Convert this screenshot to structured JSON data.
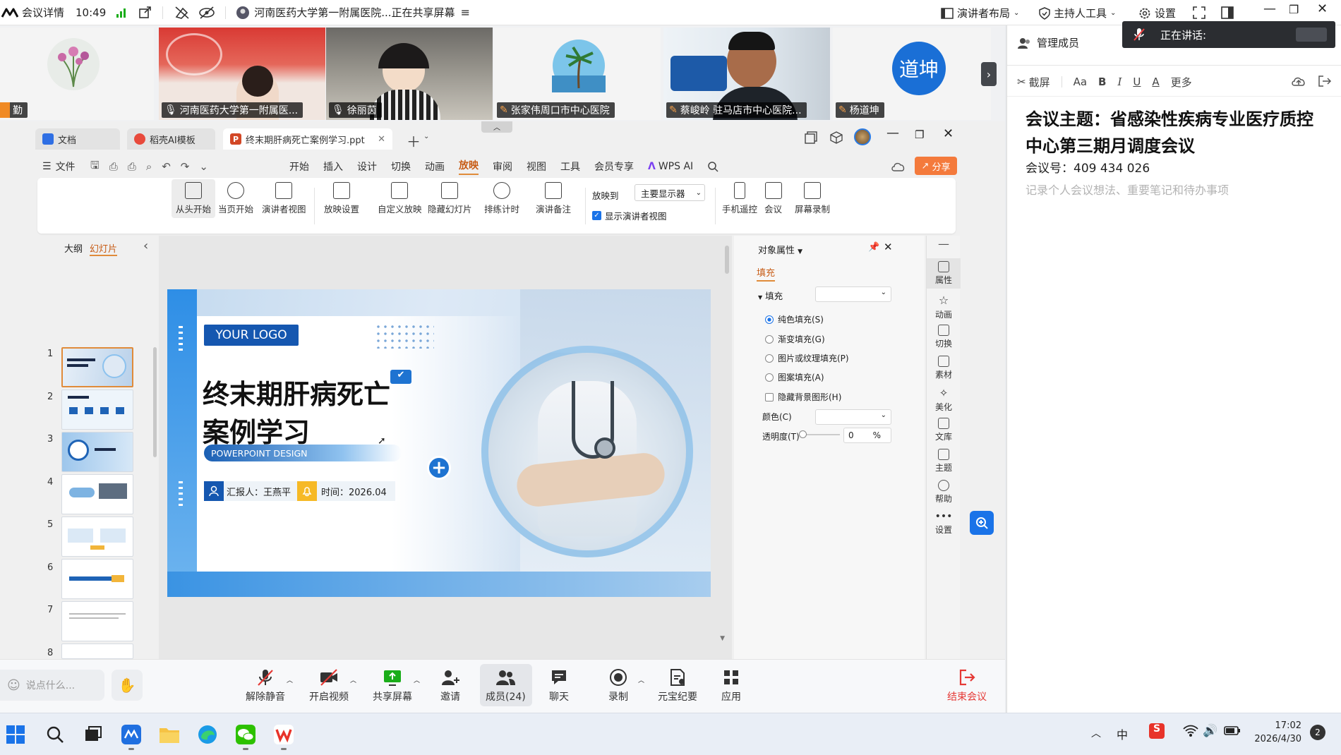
{
  "topbar": {
    "app_label": "会议详情",
    "time": "10:49",
    "meeting_title": "河南医药大学第一附属医院...正在共享屏幕",
    "layout_label": "演讲者布局",
    "host_tools_label": "主持人工具",
    "settings_label": "设置",
    "speaking_label": "正在讲话:"
  },
  "participants": [
    {
      "name": "勤",
      "muted": true
    },
    {
      "name": "河南医药大学第一附属医...",
      "muted": false
    },
    {
      "name": "徐丽茵",
      "muted": false
    },
    {
      "name": "张家伟周口市中心医院",
      "muted": true
    },
    {
      "name": "蔡峻岭 驻马店市中心医院...",
      "muted": true
    },
    {
      "name": "杨道坤",
      "muted": true,
      "avatar_text": "道坤"
    }
  ],
  "right_panel": {
    "manage_members": "管理成员",
    "toolbar": {
      "screenshot": "截屏",
      "font": "Aa",
      "bold": "B",
      "italic": "I",
      "underline": "U",
      "color": "A",
      "more": "更多"
    },
    "note_title": "会议主题：省感染性疾病专业医疗质控中心第三期月调度会议",
    "meeting_id": "会议号：409 434 026",
    "placeholder": "记录个人会议想法、重要笔记和待办事项"
  },
  "wps": {
    "tabs": [
      {
        "label": "文档"
      },
      {
        "label": "稻壳AI模板"
      },
      {
        "label": "终末期肝病死亡案例学习.ppt"
      }
    ],
    "file_menu": "文件",
    "menus": [
      "开始",
      "插入",
      "设计",
      "切换",
      "动画",
      "放映",
      "审阅",
      "视图",
      "工具",
      "会员专享"
    ],
    "active_menu": "放映",
    "wps_ai": "WPS AI",
    "share": "分享",
    "ribbon": {
      "from_start": "从头开始",
      "from_current": "当页开始",
      "presenter_view": "演讲者视图",
      "show_settings": "放映设置",
      "custom_show": "自定义放映",
      "hide_slide": "隐藏幻灯片",
      "rehearse": "排练计时",
      "notes": "演讲备注",
      "show_to": "放映到",
      "monitor": "主要显示器",
      "show_presenter": "显示演讲者视图",
      "phone_remote": "手机遥控",
      "meeting": "会议",
      "screen_record": "屏幕录制"
    },
    "panel_tabs": {
      "outline": "大纲",
      "slides": "幻灯片"
    },
    "slide_numbers": [
      "1",
      "2",
      "3",
      "4",
      "5",
      "6",
      "7",
      "8"
    ],
    "slide": {
      "logo": "YOUR LOGO",
      "title_line1": "终末期肝病死亡",
      "title_line2": "案例学习",
      "subtitle": "POWERPOINT DESIGN",
      "reporter": "汇报人：王燕平",
      "date": "时间：2026.04"
    },
    "properties": {
      "header": "对象属性",
      "fill_tab": "填充",
      "fill_section": "填充",
      "solid": "纯色填充(S)",
      "gradient": "渐变填充(G)",
      "picture": "图片或纹理填充(P)",
      "pattern": "图案填充(A)",
      "hide_bg": "隐藏背景图形(H)",
      "color": "颜色(C)",
      "transparency": "透明度(T)",
      "transparency_value": "0",
      "percent": "%"
    },
    "side_tools": [
      "属性",
      "动画",
      "切换",
      "素材",
      "美化",
      "文库",
      "主题",
      "帮助",
      "设置"
    ]
  },
  "bottombar": {
    "chat_placeholder": "说点什么...",
    "buttons": [
      "解除静音",
      "开启视频",
      "共享屏幕",
      "邀请",
      "成员(24)",
      "聊天",
      "录制",
      "元宝纪要",
      "应用"
    ],
    "end_meeting": "结束会议"
  },
  "taskbar": {
    "time": "17:02",
    "date": "2026/4/30",
    "ime": "中",
    "notifications": "2"
  },
  "colors": {
    "accent_orange": "#f05a22",
    "wps_blue": "#1a73e8",
    "slide_blue": "#1565c0",
    "end_red": "#e53935"
  }
}
